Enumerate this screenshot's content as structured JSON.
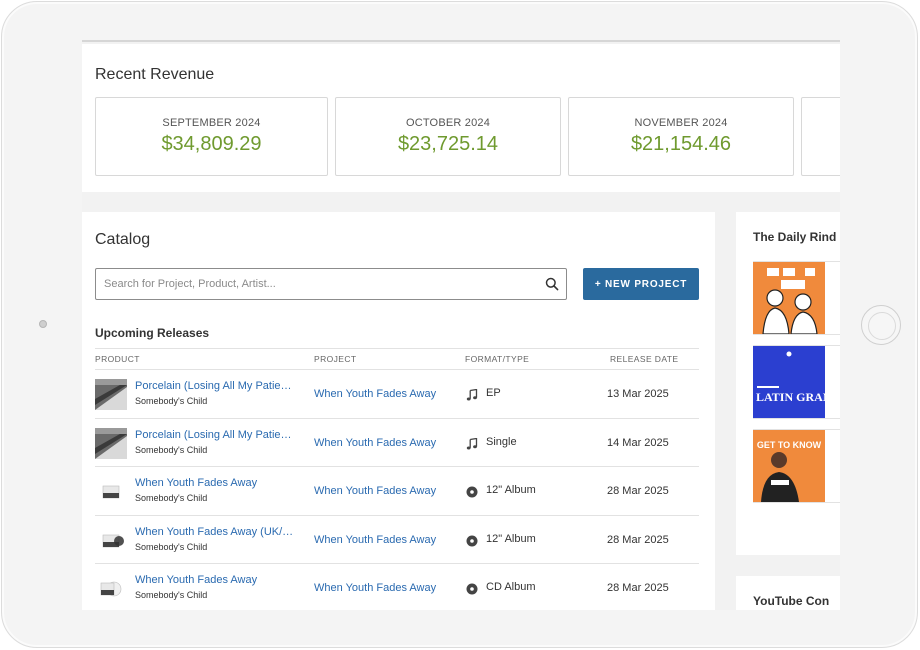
{
  "revenue": {
    "title": "Recent Revenue",
    "tiles": [
      {
        "month": "SEPTEMBER 2024",
        "amount": "$34,809.29"
      },
      {
        "month": "OCTOBER 2024",
        "amount": "$23,725.14"
      },
      {
        "month": "NOVEMBER 2024",
        "amount": "$21,154.46"
      }
    ]
  },
  "catalog": {
    "title": "Catalog",
    "search": {
      "placeholder": "Search for Project, Product, Artist..."
    },
    "new_project_label": "+ NEW PROJECT",
    "upcoming_title": "Upcoming Releases",
    "columns": [
      "PRODUCT",
      "PROJECT",
      "FORMAT/TYPE",
      "RELEASE DATE"
    ],
    "rows": [
      {
        "title": "Porcelain (Losing All My Patience)",
        "artist": "Somebody's Child",
        "project": "When Youth Fades Away",
        "format": "EP",
        "format_icon": "music-note-icon",
        "date": "13 Mar 2025"
      },
      {
        "title": "Porcelain (Losing All My Patience)",
        "artist": "Somebody's Child",
        "project": "When Youth Fades Away",
        "format": "Single",
        "format_icon": "music-note-icon",
        "date": "14 Mar 2025"
      },
      {
        "title": "When Youth Fades Away",
        "artist": "Somebody's Child",
        "project": "When Youth Fades Away",
        "format": "12\" Album",
        "format_icon": "vinyl-disc-icon",
        "date": "28 Mar 2025"
      },
      {
        "title": "When Youth Fades Away (UK/EU)",
        "artist": "Somebody's Child",
        "project": "When Youth Fades Away",
        "format": "12\" Album",
        "format_icon": "vinyl-disc-icon",
        "date": "28 Mar 2025"
      },
      {
        "title": "When Youth Fades Away",
        "artist": "Somebody's Child",
        "project": "When Youth Fades Away",
        "format": "CD Album",
        "format_icon": "cd-disc-icon",
        "date": "28 Mar 2025"
      }
    ]
  },
  "daily_rind": {
    "title": "The Daily Rind",
    "items": [
      {
        "image": "podcast-cover-orange-duo"
      },
      {
        "image": "podcast-cover-latin-grammys",
        "cover_text": "LATIN GRAMMYS"
      },
      {
        "image": "podcast-cover-get-to-know",
        "cover_text": "GET TO KNOW"
      }
    ]
  },
  "youtube": {
    "title": "YouTube Con"
  },
  "colors": {
    "accent": "#2a6a9e",
    "revenue_green": "#6f9a2f",
    "link_blue": "#2a6ab0",
    "cover_orange": "#f08a3c",
    "cover_blue": "#2b3fd0"
  }
}
